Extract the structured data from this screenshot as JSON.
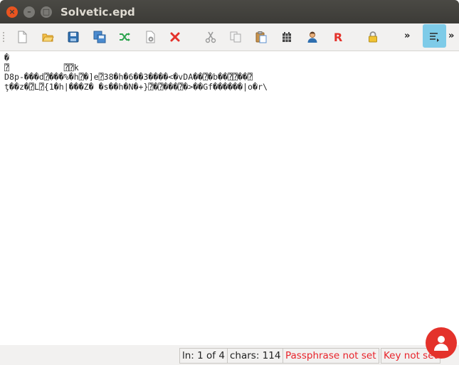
{
  "window": {
    "title": "Solvetic.epd",
    "controls": {
      "close": "×",
      "minimize": "–",
      "maximize": "□"
    }
  },
  "toolbar": {
    "icons": [
      "new-file-icon",
      "open-folder-icon",
      "save-icon",
      "save-as-icon",
      "shuffle-icon",
      "settings-page-icon",
      "delete-icon",
      "cut-icon",
      "copy-icon",
      "paste-icon",
      "chart-grid-icon",
      "user-icon",
      "r-icon",
      "lock-icon"
    ],
    "r_label": "R",
    "overflow_left": "»",
    "overflow_right": "»"
  },
  "editor": {
    "lines": [
      "�",
      "⍰           ⍰⍰k",
      "D8p-���d⍰���%�h⍰�]e⍰38�h�6��3����<�vDA��⍰�b��⍰⍰��⍰",
      "ţ��z�⍰L⍰{1�h|���Z� �s��h�N�+}⍰�⍰���⍰�>��Gf������|o�r\\"
    ]
  },
  "status": {
    "line": "ln: 1 of 4",
    "chars": "chars: 114",
    "passphrase": "Passphrase not set",
    "key": "Key not set"
  },
  "colors": {
    "accent": "#7ecbe8",
    "status_red": "#e8232a",
    "titlebar": "#3c3b37",
    "close_button": "#e95420"
  }
}
